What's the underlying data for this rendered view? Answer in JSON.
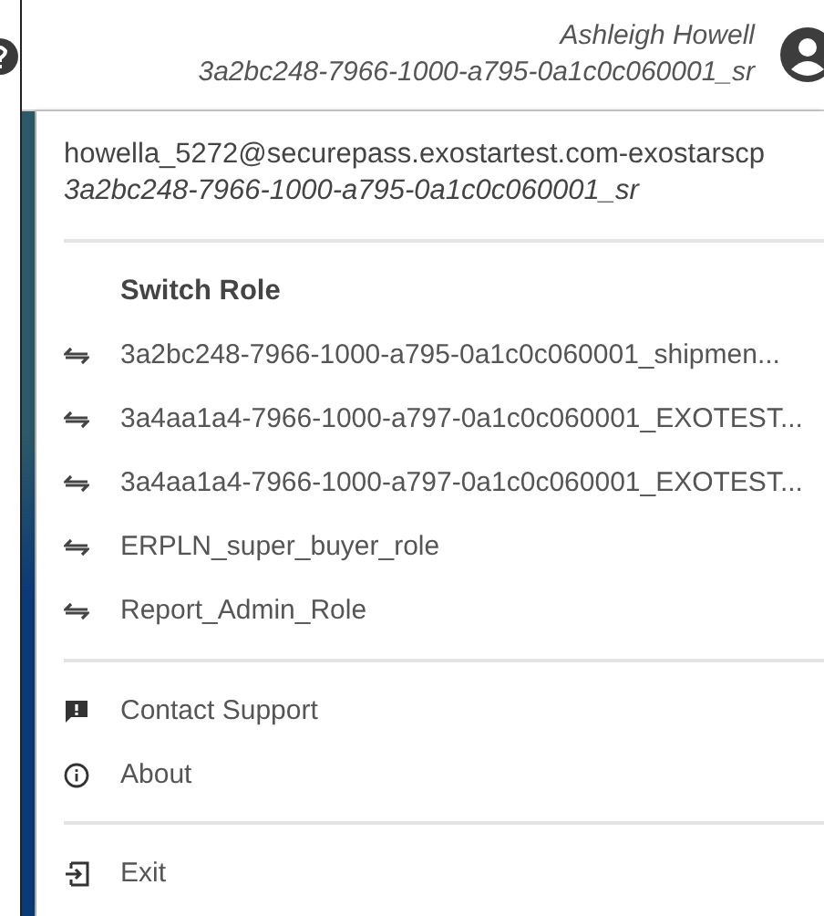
{
  "header": {
    "user_name": "Ashleigh Howell",
    "user_role": "3a2bc248-7966-1000-a795-0a1c0c060001_sr"
  },
  "menu": {
    "email": "howella_5272@securepass.exostartest.com-exostarscp",
    "current_role": "3a2bc248-7966-1000-a795-0a1c0c060001_sr",
    "switch_role_title": "Switch Role",
    "roles": [
      {
        "label": "3a2bc248-7966-1000-a795-0a1c0c060001_shipmen..."
      },
      {
        "label": "3a4aa1a4-7966-1000-a797-0a1c0c060001_EXOTEST..."
      },
      {
        "label": "3a4aa1a4-7966-1000-a797-0a1c0c060001_EXOTEST..."
      },
      {
        "label": "ERPLN_super_buyer_role"
      },
      {
        "label": "Report_Admin_Role"
      }
    ],
    "actions": [
      {
        "kind": "support",
        "label": "Contact Support"
      },
      {
        "kind": "about",
        "label": "About"
      }
    ],
    "exit": {
      "label": "Exit"
    }
  }
}
